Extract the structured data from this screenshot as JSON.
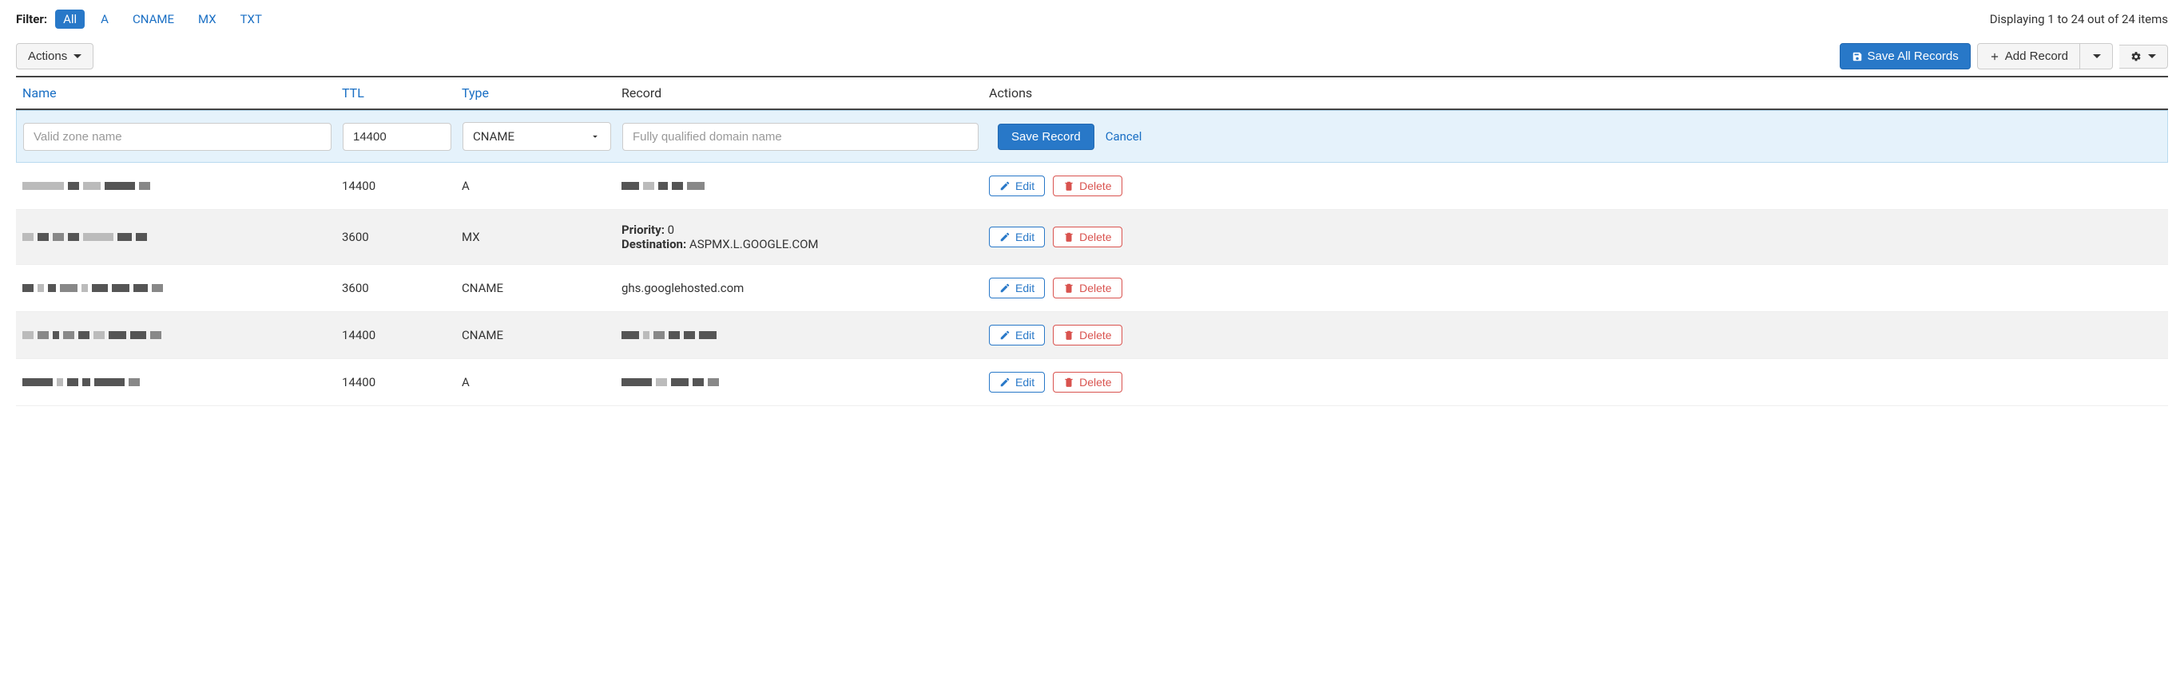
{
  "filters": {
    "label": "Filter:",
    "items": [
      "All",
      "A",
      "CNAME",
      "MX",
      "TXT"
    ],
    "active": "All"
  },
  "display_text": "Displaying 1 to 24 out of 24 items",
  "toolbar": {
    "actions_label": "Actions",
    "save_all_label": "Save All Records",
    "add_record_label": "Add Record"
  },
  "columns": {
    "name": "Name",
    "ttl": "TTL",
    "type": "Type",
    "record": "Record",
    "actions": "Actions"
  },
  "add_row": {
    "name_placeholder": "Valid zone name",
    "ttl_value": "14400",
    "type_value": "CNAME",
    "record_placeholder": "Fully qualified domain name",
    "save_label": "Save Record",
    "cancel_label": "Cancel"
  },
  "row_action_labels": {
    "edit": "Edit",
    "delete": "Delete"
  },
  "rows": [
    {
      "name": null,
      "ttl": "14400",
      "type": "A",
      "record_text": null
    },
    {
      "name": null,
      "ttl": "3600",
      "type": "MX",
      "priority_label": "Priority:",
      "priority_value": "0",
      "destination_label": "Destination:",
      "destination_value": "ASPMX.L.GOOGLE.COM"
    },
    {
      "name": null,
      "ttl": "3600",
      "type": "CNAME",
      "record_text": "ghs.googlehosted.com"
    },
    {
      "name": null,
      "ttl": "14400",
      "type": "CNAME",
      "record_text": null
    },
    {
      "name": null,
      "ttl": "14400",
      "type": "A",
      "record_text": null
    }
  ]
}
